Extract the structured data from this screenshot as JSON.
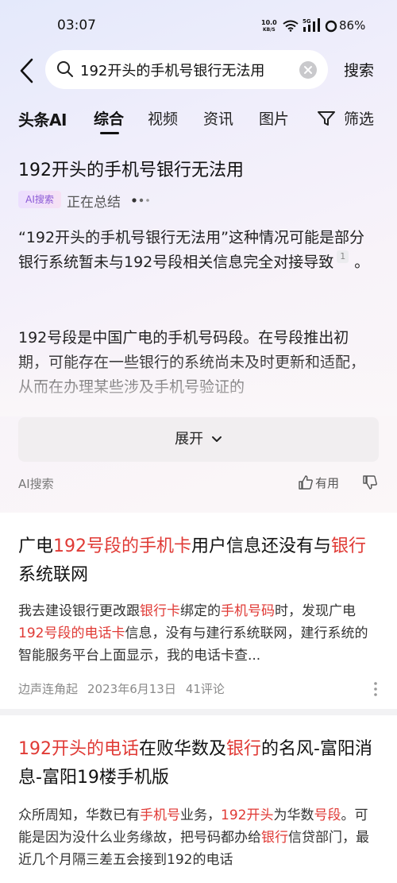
{
  "status_bar": {
    "time": "03:07",
    "net_speed_value": "10.0",
    "net_speed_unit": "KB/S",
    "signal_label": "5G",
    "battery": "86%"
  },
  "search": {
    "query": "192开头的手机号银行无法用",
    "submit_label": "搜索"
  },
  "tabs": [
    {
      "label": "头条AI"
    },
    {
      "label": "综合",
      "active": true
    },
    {
      "label": "视频"
    },
    {
      "label": "资讯"
    },
    {
      "label": "图片"
    },
    {
      "label": "筛选"
    }
  ],
  "ai_card": {
    "title": "192开头的手机号银行无法用",
    "badge": "AI搜索",
    "status": "正在总结",
    "paragraph1": "“192开头的手机号银行无法用”这种情况可能是部分银行系统暂未与192号段相关信息完全对接导致",
    "citation": "1",
    "paragraph1_end": "。",
    "paragraph2": "192号段是中国广电的手机号码段。在号段推出初期，可能存在一些银行的系统尚未及时更新和适配，从而在办理某些涉及手机号验证的",
    "expand_label": "展开",
    "source": "AI搜索",
    "useful_label": "有用"
  },
  "results": [
    {
      "title_parts": [
        {
          "text": "广电",
          "hl": false
        },
        {
          "text": "192号段的手机卡",
          "hl": true
        },
        {
          "text": "用户信息还没有与",
          "hl": false
        },
        {
          "text": "银行",
          "hl": true
        },
        {
          "text": "系统联网",
          "hl": false
        }
      ],
      "snippet_parts": [
        {
          "text": "我去建设银行更改跟",
          "hl": false
        },
        {
          "text": "银行卡",
          "hl": true
        },
        {
          "text": "绑定的",
          "hl": false
        },
        {
          "text": "手机号码",
          "hl": true
        },
        {
          "text": "时，发现广电",
          "hl": false
        },
        {
          "text": "192号段的电话卡",
          "hl": true
        },
        {
          "text": "信息，没有与建行系统联网，建行系统的智能服务平台上面显示，我的电话卡查...",
          "hl": false
        }
      ],
      "author": "边声连角起",
      "date": "2023年6月13日",
      "comments": "41评论"
    },
    {
      "title_parts": [
        {
          "text": "192开头的电话",
          "hl": true
        },
        {
          "text": "在败华数及",
          "hl": false
        },
        {
          "text": "银行",
          "hl": true
        },
        {
          "text": "的名风-富阳消息-富阳19楼手机版",
          "hl": false
        }
      ],
      "snippet_parts": [
        {
          "text": "众所周知，华数已有",
          "hl": false
        },
        {
          "text": "手机号",
          "hl": true
        },
        {
          "text": "业务，",
          "hl": false
        },
        {
          "text": "192开头",
          "hl": true
        },
        {
          "text": "为华数",
          "hl": false
        },
        {
          "text": "号段",
          "hl": true
        },
        {
          "text": "。可能是因为没什么业务缘故，把号码都办给",
          "hl": false
        },
        {
          "text": "银行",
          "hl": true
        },
        {
          "text": "信贷部门，最近几个月隔三差五会接到192的电话",
          "hl": false
        }
      ]
    }
  ],
  "colors": {
    "highlight": "#e03a35",
    "ai_badge_text": "#8b5ad6"
  }
}
